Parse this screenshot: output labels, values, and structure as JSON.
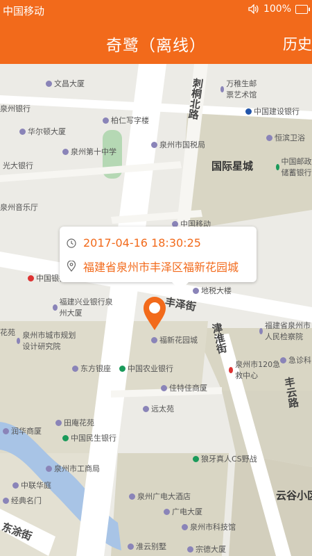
{
  "status_bar": {
    "carrier": "中国移动",
    "volume_icon": "speaker-icon",
    "battery": "100%"
  },
  "app_bar": {
    "title": "奇鹭（离线）",
    "history_label": "历史"
  },
  "popup": {
    "datetime": "2017-04-16   18:30:25",
    "address": "福建省泉州市丰泽区福新花园城",
    "clock_icon": "clock-icon",
    "location_icon": "location-pin-icon"
  },
  "map": {
    "roads": [
      "刺桐北路",
      "丰泽街",
      "津淮街",
      "丰云路",
      "东涂街"
    ],
    "areas": [
      "国际星城",
      "云谷小区"
    ],
    "pois": [
      "文昌大厦",
      "万稚生邮票艺术馆",
      "泉州银行",
      "中国建设银行",
      "柏仁写字楼",
      "华尔顿大厦",
      "泉州市国税局",
      "恒滨卫浴",
      "泉州第十中学",
      "光大银行",
      "中国邮政储蓄银行",
      "泉州音乐厅",
      "中国移动",
      "中国银行",
      "福建兴业银行泉州大厦",
      "地税大楼",
      "泉州市城市规划设计研究院",
      "福新花园城",
      "福建省泉州市人民检察院",
      "东方银座",
      "中国农业银行",
      "泉州市120急救中心",
      "急诊科",
      "佳特佳商厦",
      "远太苑",
      "田庵花苑",
      "中国民生银行",
      "润华商厦",
      "泉州市工商局",
      "狼牙真人CS野战",
      "中联华庭",
      "经典名门",
      "泉州广电大酒店",
      "广电大厦",
      "泉州市科技馆",
      "淮云别墅",
      "花苑",
      "宗德大厦"
    ]
  },
  "colors": {
    "brand": "#f26a1b",
    "map_bg": "#ecebe6",
    "road": "#ffffff",
    "block": "#d9d6c4"
  }
}
